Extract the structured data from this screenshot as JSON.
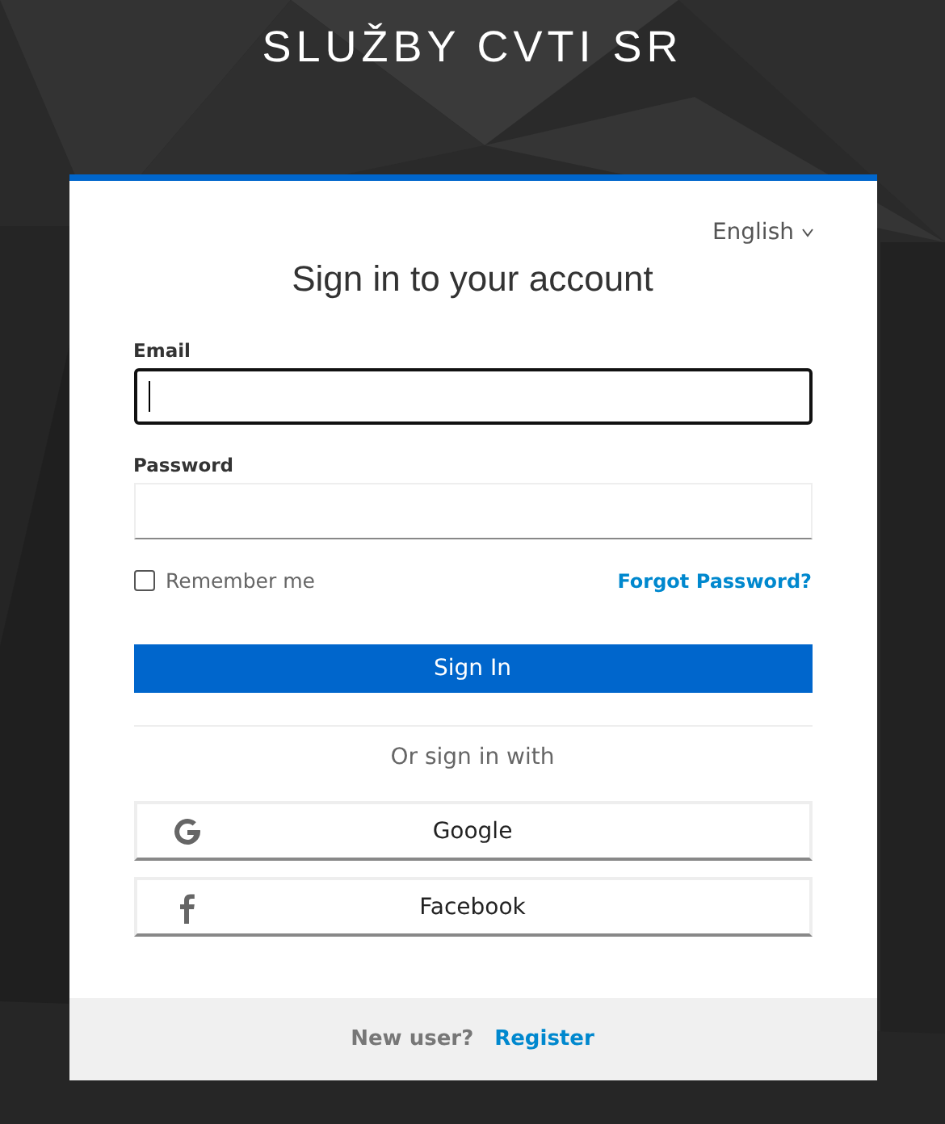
{
  "header": {
    "title": "SLUŽBY CVTI SR"
  },
  "language": {
    "label": "English"
  },
  "title": "Sign in to your account",
  "fields": [
    {
      "label": "Email",
      "focused": true
    },
    {
      "label": "Password",
      "focused": false
    }
  ],
  "remember_me": {
    "label": "Remember me",
    "checked": false
  },
  "forgot_password": "Forgot Password?",
  "sign_in_button": "Sign In",
  "separator_text": "Or sign in with",
  "providers": [
    {
      "label": "Google",
      "kind": "google"
    },
    {
      "label": "Facebook",
      "kind": "facebook"
    }
  ],
  "footer": {
    "text": "New user?",
    "link": "Register"
  }
}
